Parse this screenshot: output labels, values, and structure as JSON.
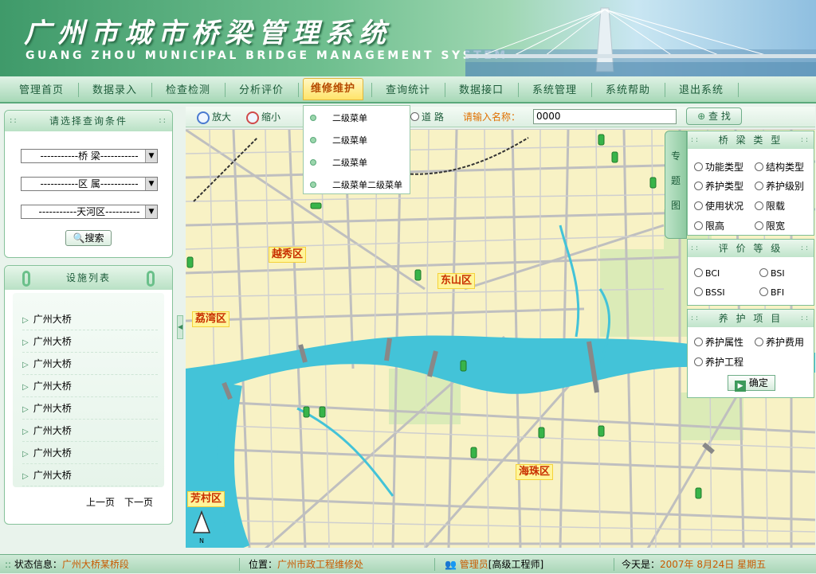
{
  "header": {
    "title": "广州市城市桥梁管理系统",
    "subtitle": "GUANG ZHOU MUNICIPAL BRIDGE MANAGEMENT SYSTEM"
  },
  "nav": {
    "items": [
      "管理首页",
      "数据录入",
      "检查检测",
      "分析评价",
      "维修维护",
      "查询统计",
      "数据接口",
      "系统管理",
      "系统帮助",
      "退出系统"
    ],
    "active": "维修维护"
  },
  "dropdown": {
    "items": [
      "二级菜单",
      "二级菜单",
      "二级菜单",
      "二级菜单二级菜单"
    ]
  },
  "query_panel": {
    "title": "请选择查询条件",
    "select1": "-----------桥 梁-----------",
    "select2": "-----------区 属-----------",
    "select3": "-----------天河区----------",
    "search_label": "搜索"
  },
  "facility_panel": {
    "title": "设施列表",
    "items": [
      "广州大桥",
      "广州大桥",
      "广州大桥",
      "广州大桥",
      "广州大桥",
      "广州大桥",
      "广州大桥",
      "广州大桥"
    ],
    "prev": "上一页",
    "next": "下一页"
  },
  "toolbar": {
    "zoom_in": "放大",
    "zoom_out": "缩小",
    "road_label": "道 路",
    "name_prompt": "请输入名称：",
    "name_value": "0000",
    "find_label": "查 找"
  },
  "map": {
    "districts": [
      "越秀区",
      "东山区",
      "荔湾区",
      "海珠区",
      "芳村区"
    ],
    "north_label": "N"
  },
  "topic_tab": {
    "chars": [
      "专",
      "题",
      "图"
    ]
  },
  "right_panel": {
    "bridge_type": {
      "title": "桥 梁 类 型",
      "options": [
        "功能类型",
        "结构类型",
        "养护类型",
        "养护级别",
        "使用状况",
        "限载",
        "限高",
        "限宽"
      ]
    },
    "eval_level": {
      "title": "评 价 等 级",
      "options": [
        "BCI",
        "BSI",
        "BSSI",
        "BFI"
      ]
    },
    "maintenance": {
      "title": "养 护 项 目",
      "options": [
        "养护属性",
        "养护费用",
        "养护工程"
      ],
      "confirm_label": "确定"
    }
  },
  "status": {
    "state_label": "状态信息：",
    "state_value": "广州大桥某桥段",
    "location_label": "位置：",
    "location_value": "广州市政工程维修处",
    "user_role": "管理员",
    "user_title": "[高级工程师]",
    "date_label": "今天是：",
    "date_value": "2007年 8月24日 星期五"
  },
  "colors": {
    "accent": "#5aa97a",
    "highlight": "#c85a00",
    "river": "#43c3d8",
    "map_bg": "#f8f2c5"
  }
}
